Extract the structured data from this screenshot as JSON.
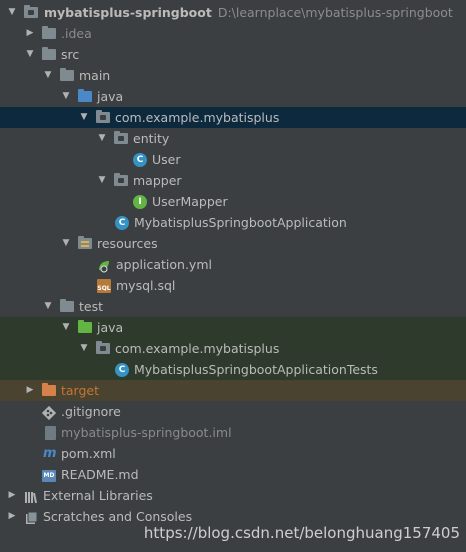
{
  "project": {
    "name": "mybatisplus-springboot",
    "path": "D:\\learnplace\\mybatisplus-springboot"
  },
  "tree": {
    "idea": ".idea",
    "src": "src",
    "main": "main",
    "java": "java",
    "package": "com.example.mybatisplus",
    "entity": "entity",
    "user": "User",
    "mapper": "mapper",
    "user_mapper": "UserMapper",
    "application": "MybatisplusSpringbootApplication",
    "resources": "resources",
    "application_yml": "application.yml",
    "mysql_sql": "mysql.sql",
    "test": "test",
    "test_java": "java",
    "test_package": "com.example.mybatisplus",
    "test_class": "MybatisplusSpringbootApplicationTests",
    "target": "target",
    "gitignore": ".gitignore",
    "iml": "mybatisplus-springboot.iml",
    "pom": "pom.xml",
    "readme": "README.md",
    "external_libraries": "External Libraries",
    "scratches": "Scratches and Consoles"
  },
  "icons": {
    "collapsed_arrow": "▶",
    "expanded_arrow": "▼",
    "class_letter": "C",
    "interface_letter": "I",
    "maven_letter": "m",
    "md_letter": "MD",
    "sql_letter": "SQL"
  },
  "colors": {
    "background": "#3c3f41",
    "selection": "#0d293e",
    "test_background": "#2d3a2c",
    "excluded_background": "#49432f",
    "source_folder": "#4a88c7",
    "test_folder": "#62b543",
    "excluded_text": "#c57633"
  },
  "watermark": "https://blog.csdn.net/belonghuang157405"
}
